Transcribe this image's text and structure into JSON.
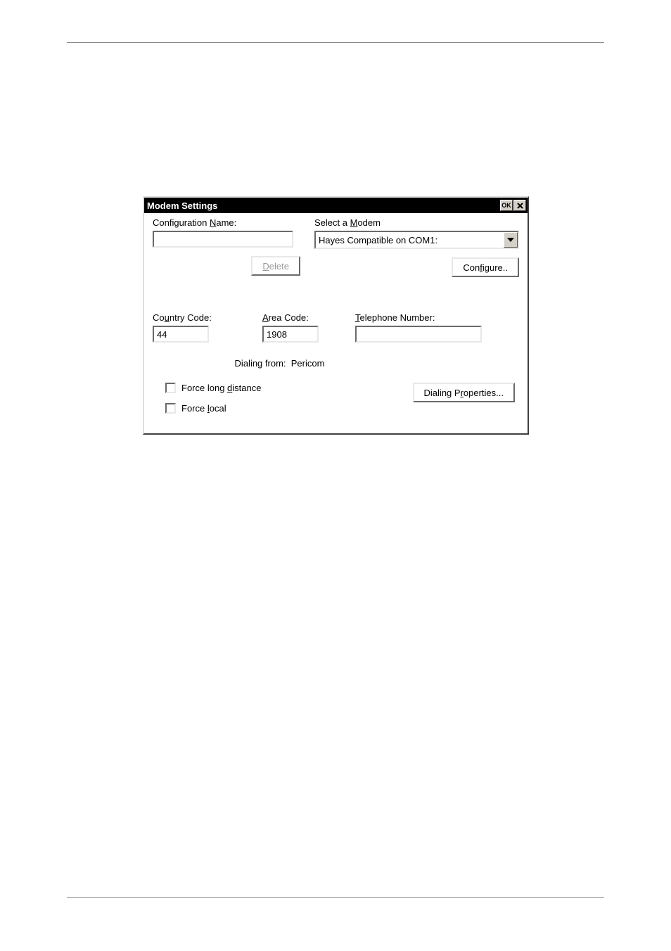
{
  "dialog": {
    "title": "Modem Settings",
    "config_name_label_pre": "Configuration ",
    "config_name_label_u": "N",
    "config_name_label_post": "ame:",
    "config_name_value": "",
    "select_modem_label_pre": "Select a ",
    "select_modem_label_u": "M",
    "select_modem_label_post": "odem",
    "modem_value": "Hayes Compatible on COM1:",
    "delete_label_u": "D",
    "delete_label_post": "elete",
    "configure_label_pre": "Con",
    "configure_label_u": "f",
    "configure_label_post": "igure..",
    "country_label_pre": "Co",
    "country_label_u": "u",
    "country_label_post": "ntry Code:",
    "country_value": "44",
    "area_label_u": "A",
    "area_label_post": "rea Code:",
    "area_value": "1908",
    "tel_label_u": "T",
    "tel_label_post": "elephone Number:",
    "tel_value": "",
    "dialing_from_label": "Dialing from:",
    "dialing_from_value": "Pericom",
    "force_ld_pre": "Force long ",
    "force_ld_u": "d",
    "force_ld_post": "istance",
    "force_local_pre": "Force ",
    "force_local_u": "l",
    "force_local_post": "ocal",
    "dial_props_pre": "Dialing P",
    "dial_props_u": "r",
    "dial_props_post": "operties..."
  }
}
